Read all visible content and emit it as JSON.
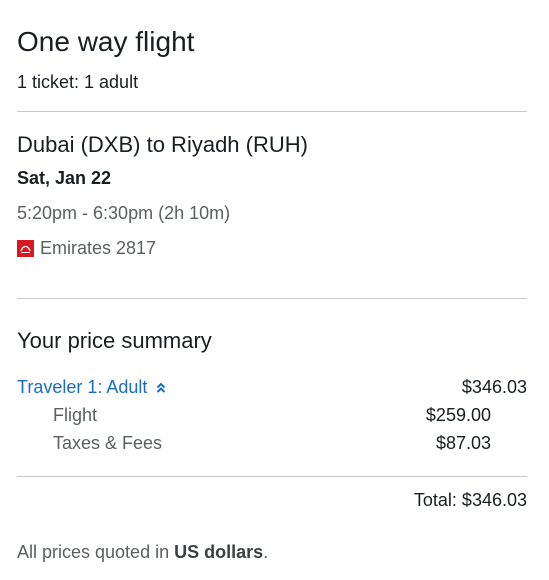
{
  "header": {
    "title": "One way flight",
    "tickets": "1 ticket: 1 adult"
  },
  "itinerary": {
    "route": "Dubai (DXB) to Riyadh (RUH)",
    "date": "Sat, Jan 22",
    "times": "5:20pm - 6:30pm (2h 10m)",
    "airline": "Emirates 2817",
    "airline_icon": "emirates-logo-icon",
    "airline_color": "#d71921"
  },
  "price_summary": {
    "title": "Your price summary",
    "traveler_label": "Traveler 1: Adult",
    "traveler_total": "$346.03",
    "lines": [
      {
        "label": "Flight",
        "value": "$259.00"
      },
      {
        "label": "Taxes & Fees",
        "value": "$87.03"
      }
    ],
    "total": "Total: $346.03"
  },
  "footer": {
    "prefix": "All prices quoted in ",
    "currency": "US dollars",
    "suffix": "."
  },
  "colors": {
    "link": "#1a6cbf",
    "muted_text": "#5b5f63",
    "divider": "#c9c9c9"
  }
}
